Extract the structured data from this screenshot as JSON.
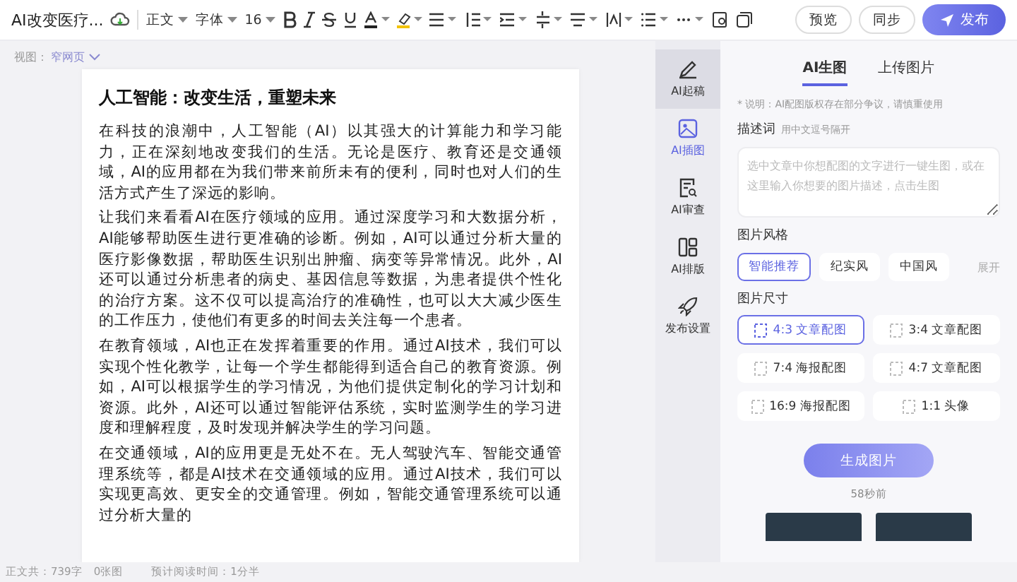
{
  "toolbar": {
    "doc_title": "AI改变医疗...",
    "paragraph_style": "正文",
    "font": "字体",
    "font_size": "16",
    "preview_button": "预览",
    "sync_button": "同步",
    "publish_button": "发布"
  },
  "view": {
    "label": "视图：",
    "value": "窄网页"
  },
  "document": {
    "title": "人工智能：改变生活，重塑未来",
    "paragraphs": [
      "在科技的浪潮中，人工智能（AI）以其强大的计算能力和学习能力，正在深刻地改变我们的生活。无论是医疗、教育还是交通领域，AI的应用都在为我们带来前所未有的便利，同时也对人们的生活方式产生了深远的影响。",
      "让我们来看看AI在医疗领域的应用。通过深度学习和大数据分析，AI能够帮助医生进行更准确的诊断。例如，AI可以通过分析大量的医疗影像数据，帮助医生识别出肿瘤、病变等异常情况。此外，AI还可以通过分析患者的病史、基因信息等数据，为患者提供个性化的治疗方案。这不仅可以提高治疗的准确性，也可以大大减少医生的工作压力，使他们有更多的时间去关注每一个患者。",
      "在教育领域，AI也正在发挥着重要的作用。通过AI技术，我们可以实现个性化教学，让每一个学生都能得到适合自己的教育资源。例如，AI可以根据学生的学习情况，为他们提供定制化的学习计划和资源。此外，AI还可以通过智能评估系统，实时监测学生的学习进度和理解程度，及时发现并解决学生的学习问题。",
      "在交通领域，AI的应用更是无处不在。无人驾驶汽车、智能交通管理系统等，都是AI技术在交通领域的应用。通过AI技术，我们可以实现更高效、更安全的交通管理。例如，智能交通管理系统可以通过分析大量的"
    ]
  },
  "status_bar": {
    "word_count": "正文共：739字",
    "image_count": "0张图",
    "reading_time": "预计阅读时间：1分半"
  },
  "rail": [
    {
      "label": "AI起稿",
      "kind": "pen",
      "selected": false
    },
    {
      "label": "AI插图",
      "kind": "image",
      "selected": true
    },
    {
      "label": "AI审查",
      "kind": "review",
      "selected": false
    },
    {
      "label": "AI排版",
      "kind": "layout",
      "selected": false
    },
    {
      "label": "发布设置",
      "kind": "rocket",
      "selected": false
    }
  ],
  "panel": {
    "tabs": [
      {
        "label": "AI生图",
        "selected": true
      },
      {
        "label": "上传图片",
        "selected": false
      }
    ],
    "note": "* 说明：AI配图版权存在部分争议，请慎重使用",
    "prompt_label": "描述词",
    "prompt_hint": "用中文逗号隔开",
    "prompt_placeholder": "选中文章中你想配图的文字进行一键生图，或在这里输入你想要的图片描述，点击生图",
    "style_label": "图片风格",
    "styles": [
      {
        "label": "智能推荐",
        "selected": true
      },
      {
        "label": "纪实风",
        "selected": false
      },
      {
        "label": "中国风",
        "selected": false
      }
    ],
    "expand_link": "展开",
    "size_label": "图片尺寸",
    "sizes": [
      {
        "label": "4:3 文章配图",
        "selected": true
      },
      {
        "label": "3:4 文章配图",
        "selected": false
      },
      {
        "label": "7:4 海报配图",
        "selected": false
      },
      {
        "label": "4:7 文章配图",
        "selected": false
      },
      {
        "label": "16:9 海报配图",
        "selected": false
      },
      {
        "label": "1:1 头像",
        "selected": false
      }
    ],
    "generate_button": "生成图片",
    "timestamp": "58秒前"
  }
}
